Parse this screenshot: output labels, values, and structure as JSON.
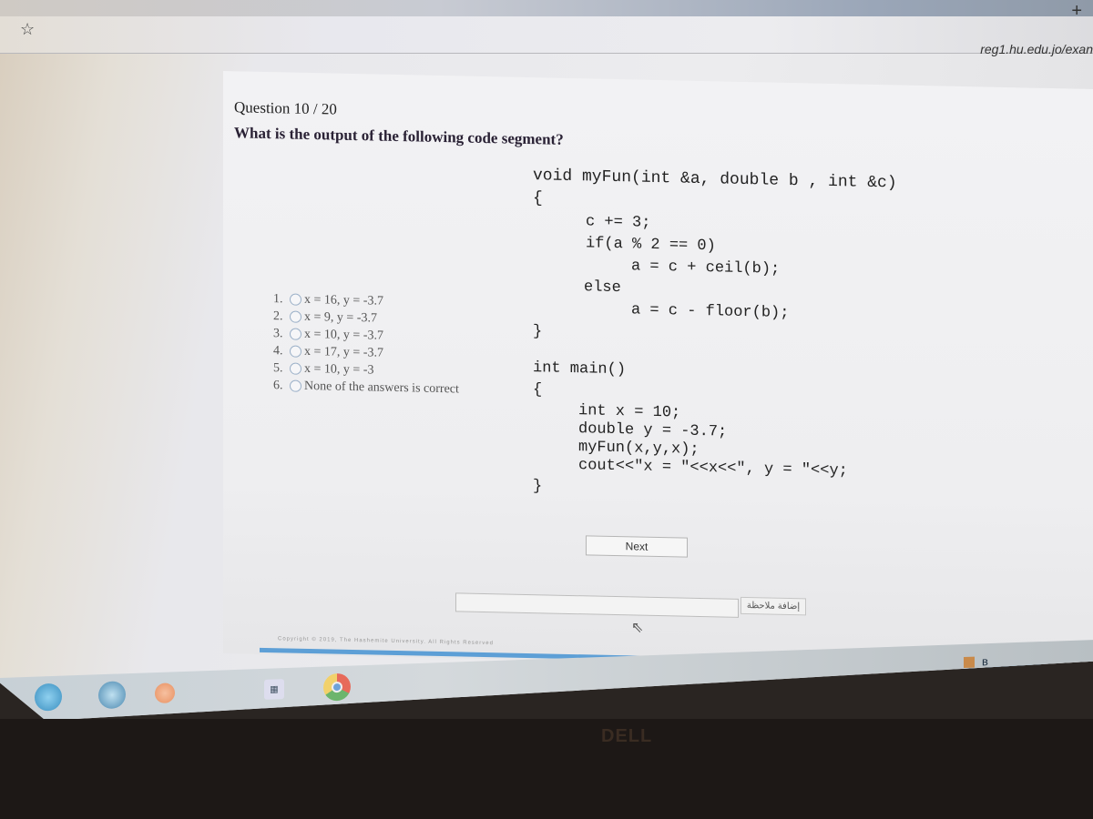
{
  "browser": {
    "new_tab_icon": "plus-icon",
    "bookmark_icon": "star-icon",
    "url": "reg1.hu.edu.jo/exan"
  },
  "question": {
    "title": "Question 10 / 20",
    "prompt": "What is the output of the following code segment?"
  },
  "options": [
    {
      "number": "1.",
      "label": "x = 16, y = -3.7",
      "selected": false
    },
    {
      "number": "2.",
      "label": "x = 9, y = -3.7",
      "selected": false
    },
    {
      "number": "3.",
      "label": "x = 10, y = -3.7",
      "selected": false
    },
    {
      "number": "4.",
      "label": "x = 17, y = -3.7",
      "selected": false
    },
    {
      "number": "5.",
      "label": "x = 10, y = -3",
      "selected": false
    },
    {
      "number": "6.",
      "label": "None of the answers is correct",
      "selected": false
    }
  ],
  "code": [
    "void myFun(int &a, double b , int &c)",
    "{",
    "c += 3;",
    "if(a % 2 == 0)",
    "a = c + ceil(b);",
    "else",
    "a = c - floor(b);",
    "}",
    "int main()",
    "{",
    "int x = 10;",
    "double y = -3.7;",
    "myFun(x,y,x);",
    "cout<<\"x = \"<<x<<\", y = \"<<y;",
    "}"
  ],
  "buttons": {
    "next": "Next",
    "add_note": "إضافة ملاحظة"
  },
  "note_input": {
    "value": "",
    "placeholder": ""
  },
  "footer": {
    "copyright": "Copyright © 2019, The Hashemite University. All Rights Reserved"
  },
  "taskbar": {
    "icons": [
      "windows-start-icon",
      "internet-explorer-icon",
      "media-player-icon",
      "app-icon",
      "chrome-icon"
    ],
    "tray_icons": [
      "tray-app-icon",
      "bluetooth-icon"
    ]
  },
  "hardware": {
    "brand": "DELL"
  }
}
